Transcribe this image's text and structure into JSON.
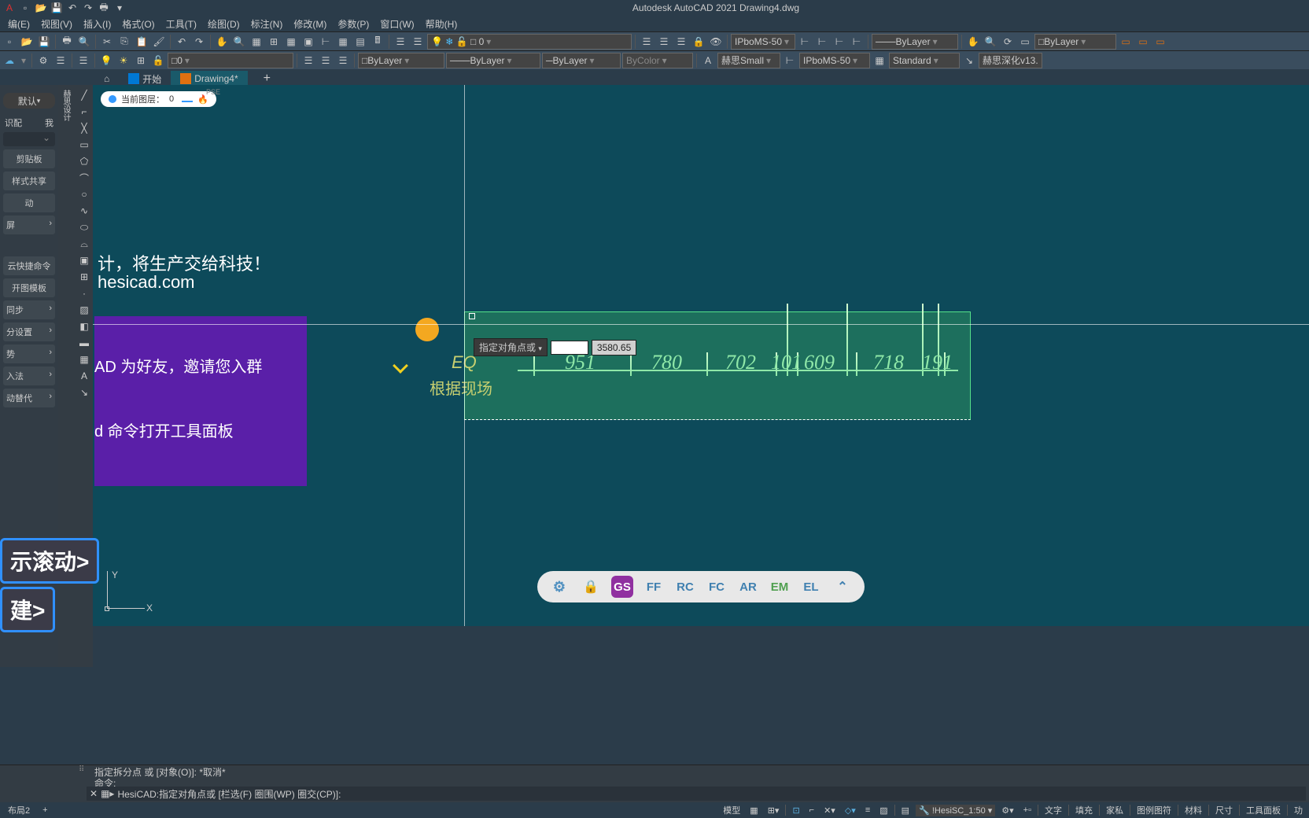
{
  "app": {
    "title": "Autodesk AutoCAD 2021   Drawing4.dwg"
  },
  "menu": [
    "编(E)",
    "视图(V)",
    "插入(I)",
    "格式(O)",
    "工具(T)",
    "绘图(D)",
    "标注(N)",
    "修改(M)",
    "参数(P)",
    "窗口(W)",
    "帮助(H)"
  ],
  "toolbar1": {
    "layer_combo": "0",
    "line_style": "IPboMS-50",
    "linetype": "ByLayer",
    "linetype2": "ByLayer"
  },
  "toolbar2": {
    "layer_combo": "0",
    "prop1": "ByLayer",
    "prop2": "ByLayer",
    "prop3": "ByLayer",
    "prop4": "ByColor",
    "text_style": "赫思Small",
    "dim_style": "IPboMS-50",
    "table_style": "Standard",
    "ext": "赫思深化v13."
  },
  "tabs": {
    "home": "开始",
    "active": "Drawing4*"
  },
  "layer_chip": {
    "label": "当前图层：",
    "value": "0"
  },
  "left_panel": {
    "top_dd": "默认",
    "row_labels": [
      "识配",
      "我"
    ],
    "items": [
      "剪贴板",
      "样式共享",
      "动",
      "屏",
      "云快捷命令",
      "开图模板",
      "同步",
      "分设置",
      "势",
      "入法",
      "动替代"
    ]
  },
  "watermark": {
    "l1": "计，将生产交给科技！",
    "l2": "hesicad.com",
    "p1": "AD 为好友，邀请您入群",
    "p2": "d  命令打开工具面板"
  },
  "dims": {
    "eq": "EQ",
    "under": "根据现场",
    "nums": [
      "951",
      "780",
      "702",
      "101",
      "609",
      "718",
      "191"
    ]
  },
  "dyn": {
    "label": "指定对角点或",
    "value": "3580.65"
  },
  "scroll_hints": {
    "h1": "示滚动>",
    "h2": "建>"
  },
  "ctx_dock": [
    "GS",
    "FF",
    "RC",
    "FC",
    "AR",
    "EM",
    "EL"
  ],
  "cmd": {
    "hist1": "指定拆分点 或 [对象(O)]: *取消*",
    "hist2": "命令:",
    "prompt_prefix": "HesiCAD:",
    "prompt_text": "指定对角点或 [栏选(F) 圈围(WP) 圈交(CP)]:"
  },
  "layout": {
    "tab": "布局2"
  },
  "status": {
    "model": "模型",
    "scale": "!HesiSC_1:50",
    "items": [
      "文字",
      "填充",
      "家私",
      "图例图符",
      "材料",
      "尺寸",
      "工具面板",
      "功"
    ]
  },
  "ucs": {
    "x": "X",
    "y": "Y"
  }
}
